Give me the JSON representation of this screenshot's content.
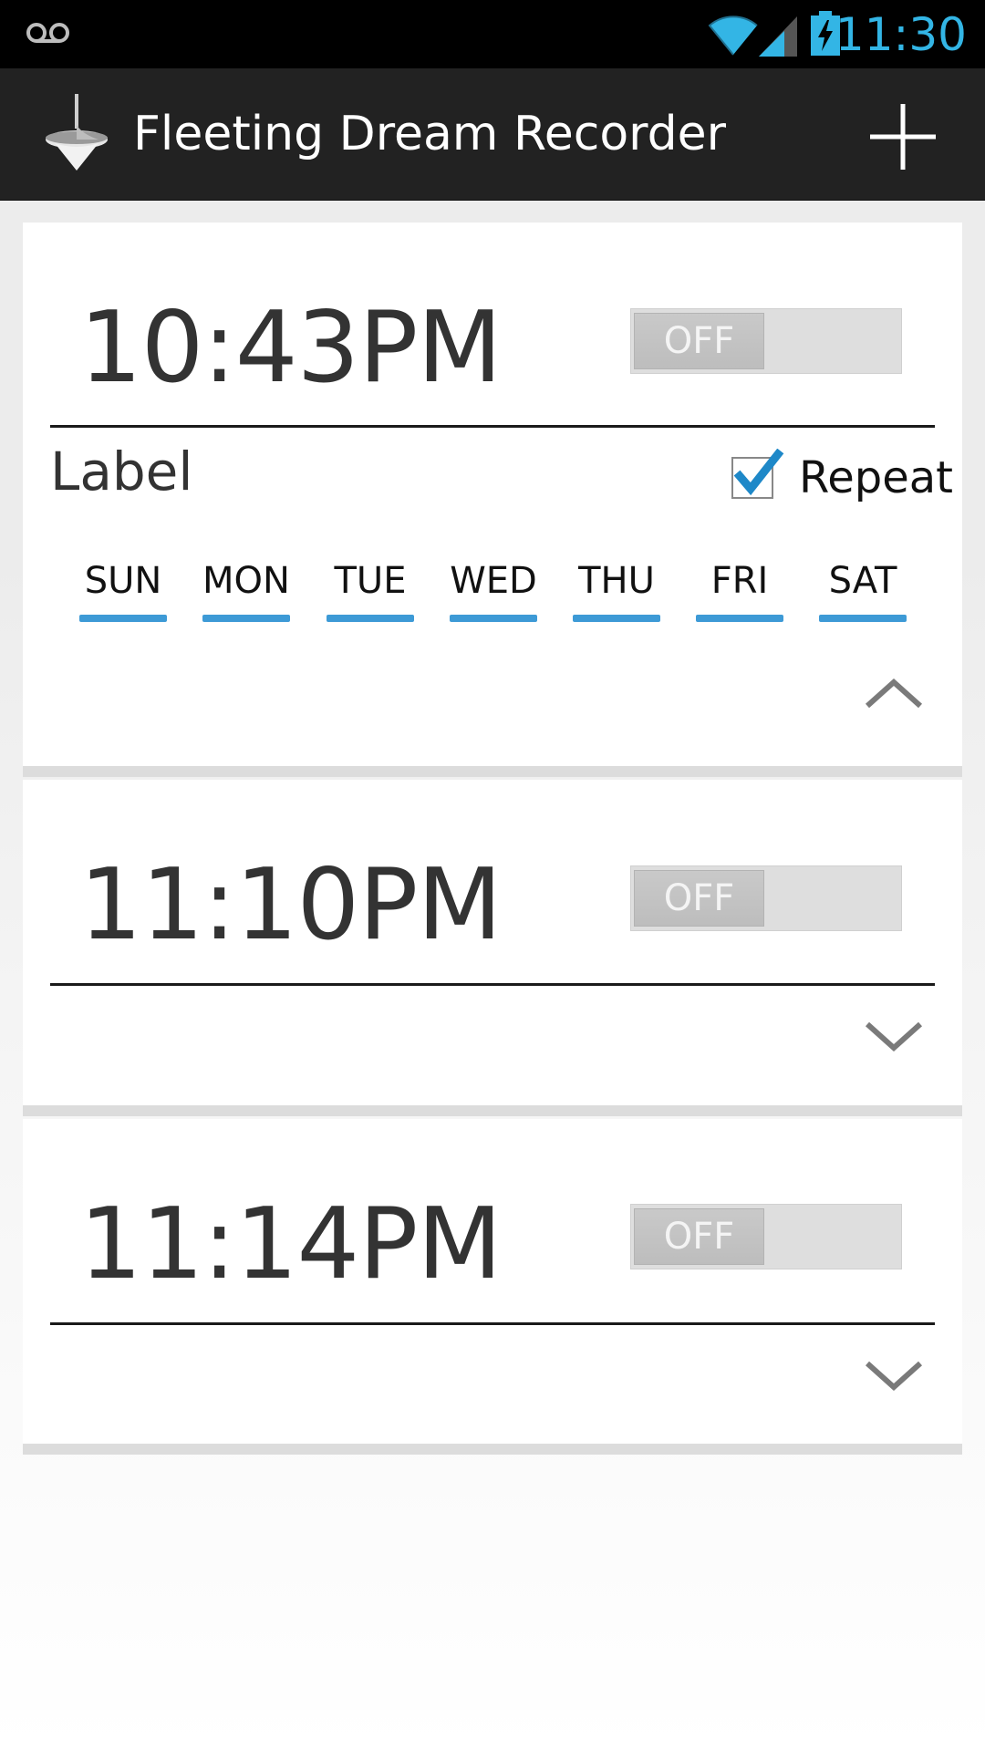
{
  "status_bar": {
    "time": "11:30",
    "icons": [
      "voicemail-icon",
      "wifi-icon",
      "signal-icon",
      "battery-charging-icon"
    ]
  },
  "action_bar": {
    "title": "Fleeting Dream Recorder",
    "app_icon": "spinning-top-icon",
    "add_icon": "plus-icon"
  },
  "alarms": [
    {
      "time": "10:43PM",
      "switch_label": "OFF",
      "expanded": true,
      "label": "Label",
      "repeat_label": "Repeat",
      "repeat_checked": true,
      "days": [
        "SUN",
        "MON",
        "TUE",
        "WED",
        "THU",
        "FRI",
        "SAT"
      ],
      "chevron": "chevron-up-icon"
    },
    {
      "time": "11:10PM",
      "switch_label": "OFF",
      "expanded": false,
      "chevron": "chevron-down-icon"
    },
    {
      "time": "11:14PM",
      "switch_label": "OFF",
      "expanded": false,
      "chevron": "chevron-down-icon"
    }
  ],
  "colors": {
    "accent": "#33b5e5",
    "day_underline": "#3d9ad6",
    "action_bar": "#222222",
    "switch_off": "#dedede"
  }
}
